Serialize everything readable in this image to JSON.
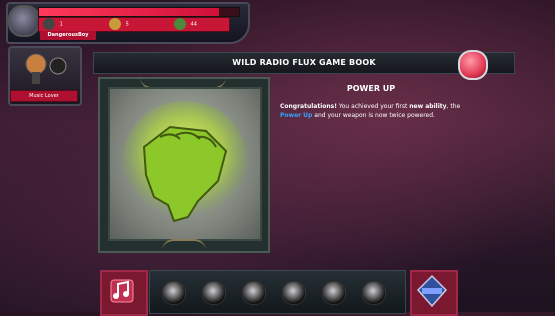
{
  "hud": {
    "player_name": "DangerousBoy",
    "stats": [
      "1",
      "5",
      "44"
    ]
  },
  "item": {
    "label": "Music Lover"
  },
  "book": {
    "title": "WILD RADIO FLUX GAME BOOK",
    "entry": {
      "title": "POWER UP",
      "text_1": "Congratulations!",
      "text_2": " You achieved your first ",
      "text_3": "new ability",
      "text_4": ", the ",
      "text_5": "Power Up",
      "text_6": " and your weapon is now twice powered."
    }
  },
  "icons": {
    "close": "close-icon",
    "music_note": "music-note-icon",
    "badge": "badge-icon"
  },
  "colors": {
    "accent_red": "#c81636",
    "highlight_blue": "#37a3ff"
  },
  "health_level": 0.9
}
